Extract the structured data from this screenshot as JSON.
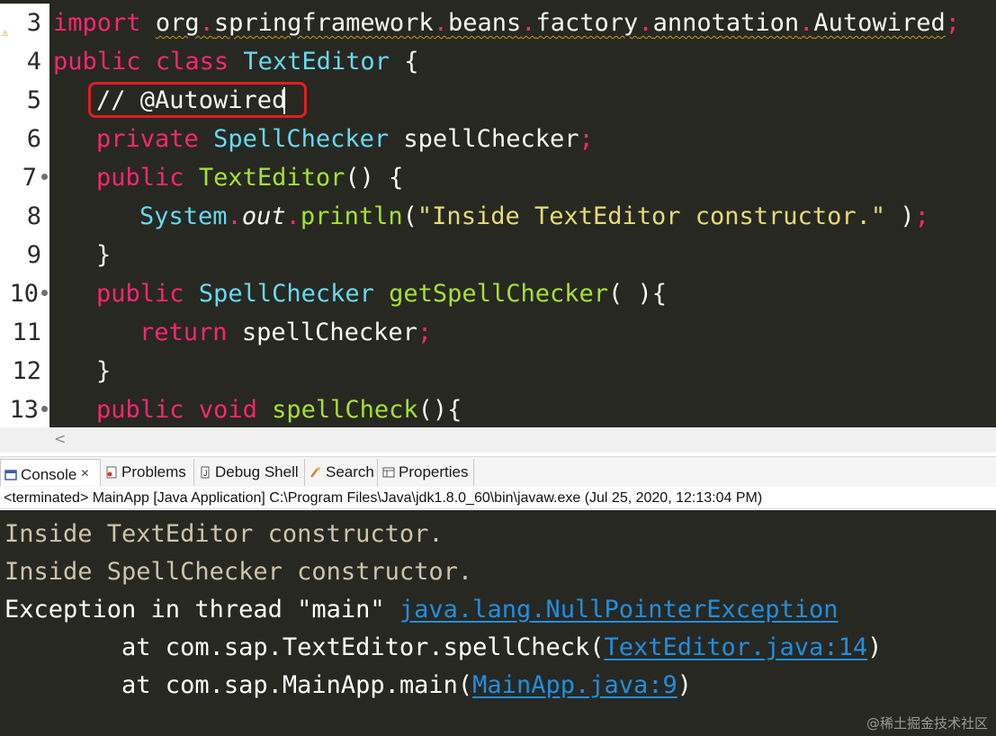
{
  "editor": {
    "line_numbers": [
      "3",
      "4",
      "5",
      "6",
      "7",
      "8",
      "9",
      "10",
      "11",
      "12",
      "13"
    ],
    "lines": [
      {
        "import_kw": "import",
        "pkg": [
          "org",
          "springframework",
          "beans",
          "factory",
          "annotation",
          "Autowired"
        ],
        "semi": ";"
      },
      {
        "kw1": "public",
        "kw2": "class",
        "type": "TextEditor",
        "brace": "{"
      },
      {
        "comment": "// @Autowired"
      },
      {
        "kw": "private",
        "type": "SpellChecker",
        "name": "spellChecker",
        "semi": ";"
      },
      {
        "kw": "public",
        "fn": "TextEditor",
        "rest": "() {"
      },
      {
        "type": "System",
        "dot": ".",
        "field": "out",
        "dot2": ".",
        "fn": "println",
        "open": "(",
        "str": "\"Inside TextEditor constructor.\"",
        "close": " )",
        "semi": ";"
      },
      {
        "brace": "}"
      },
      {
        "kw": "public",
        "type": "SpellChecker",
        "fn": "getSpellChecker",
        "rest": "( ){"
      },
      {
        "kw": "return",
        "name": "spellChecker",
        "semi": ";"
      },
      {
        "brace": "}"
      },
      {
        "kw1": "public",
        "kw2": "void",
        "fn": "spellCheck",
        "rest": "(){"
      }
    ]
  },
  "tabs": [
    {
      "label": "Console",
      "icon": "console-icon",
      "active": true
    },
    {
      "label": "Problems",
      "icon": "problems-icon"
    },
    {
      "label": "Debug Shell",
      "icon": "debug-shell-icon"
    },
    {
      "label": "Search",
      "icon": "search-icon"
    },
    {
      "label": "Properties",
      "icon": "properties-icon"
    }
  ],
  "status": "<terminated> MainApp [Java Application] C:\\Program Files\\Java\\jdk1.8.0_60\\bin\\javaw.exe (Jul 25, 2020, 12:13:04 PM)",
  "console": {
    "line1": "Inside TextEditor constructor.",
    "line2": "Inside SpellChecker constructor.",
    "line3_prefix": "Exception in thread \"main\" ",
    "line3_link": "java.lang.NullPointerException",
    "line4_prefix": "        at com.sap.TextEditor.spellCheck(",
    "line4_link": "TextEditor.java:14",
    "line4_suffix": ")",
    "line5_prefix": "        at com.sap.MainApp.main(",
    "line5_link": "MainApp.java:9",
    "line5_suffix": ")"
  },
  "watermark": "@稀土掘金技术社区",
  "colors": {
    "keyword": "#f92672",
    "type": "#66d9ef",
    "function": "#a6e22e",
    "string": "#e6db74",
    "link": "#1f8fe0",
    "background": "#272822"
  }
}
